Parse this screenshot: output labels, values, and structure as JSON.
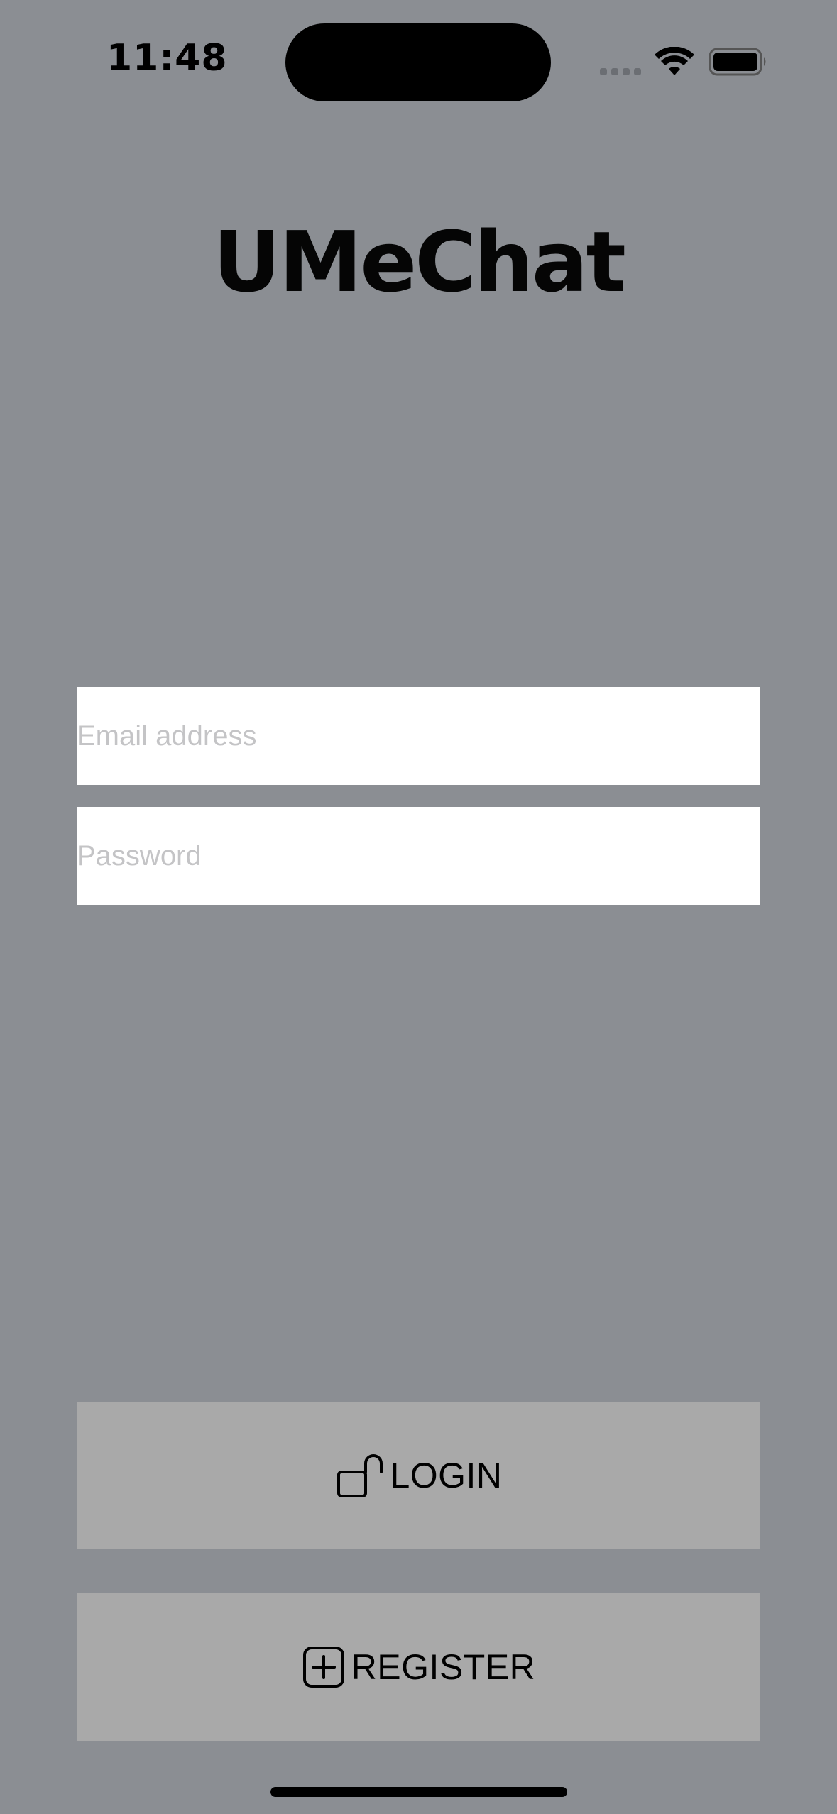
{
  "status_bar": {
    "time": "11:48"
  },
  "app": {
    "title": "UMeChat"
  },
  "form": {
    "email": {
      "value": "",
      "placeholder": "Email address"
    },
    "password": {
      "value": "",
      "placeholder": "Password"
    }
  },
  "buttons": {
    "login": {
      "label": "LOGIN",
      "icon": "lock-open-icon"
    },
    "register": {
      "label": "REGISTER",
      "icon": "plus-square-icon"
    }
  },
  "colors": {
    "background": "#8b8e93",
    "button_background": "#a9a9a9",
    "field_background": "#ffffff",
    "placeholder": "#c4c4c6",
    "text": "#000000"
  }
}
